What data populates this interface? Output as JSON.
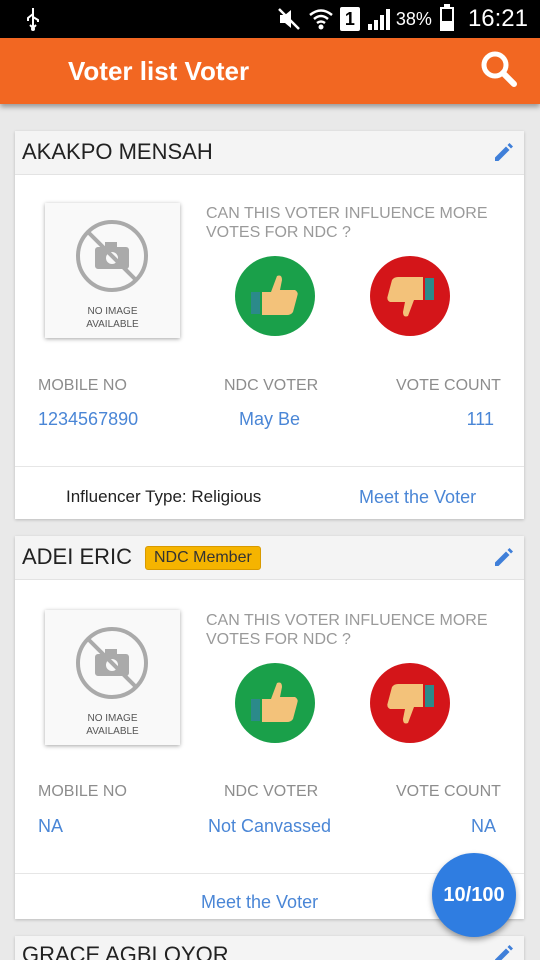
{
  "status_bar": {
    "sim_slot": "1",
    "battery": "38%",
    "time": "16:21",
    "icons": [
      "usb-icon",
      "mute-icon",
      "wifi-icon",
      "signal-icon",
      "battery-icon"
    ]
  },
  "app_bar": {
    "title": "Voter list Voter",
    "search_icon": "search-icon",
    "color": "#f26722"
  },
  "question": "CAN THIS VOTER INFLUENCE MORE VOTES FOR NDC ?",
  "no_image": {
    "line1": "NO IMAGE",
    "line2": "AVAILABLE"
  },
  "labels": {
    "mobile": "MOBILE NO",
    "ndc_voter": "NDC VOTER",
    "vote_count": "VOTE COUNT"
  },
  "cards": [
    {
      "name": "AKAKPO MENSAH",
      "mobile": "1234567890",
      "ndc_voter": "May Be",
      "vote_count": "111",
      "influencer_type": "Influencer Type: Religious",
      "meet_link": "Meet the Voter"
    },
    {
      "name": "ADEI ERIC",
      "badge": "NDC Member",
      "mobile": "NA",
      "ndc_voter": "Not Canvassed",
      "vote_count": "NA",
      "meet_link": "Meet the Voter"
    },
    {
      "name": "GRACE AGBLOYOR"
    }
  ],
  "fab": {
    "label": "10/100"
  },
  "colors": {
    "link": "#4a86d6",
    "thumb_up": "#1aa04a",
    "thumb_down": "#d41519",
    "badge": "#f5b400",
    "fab": "#2f7de1"
  }
}
